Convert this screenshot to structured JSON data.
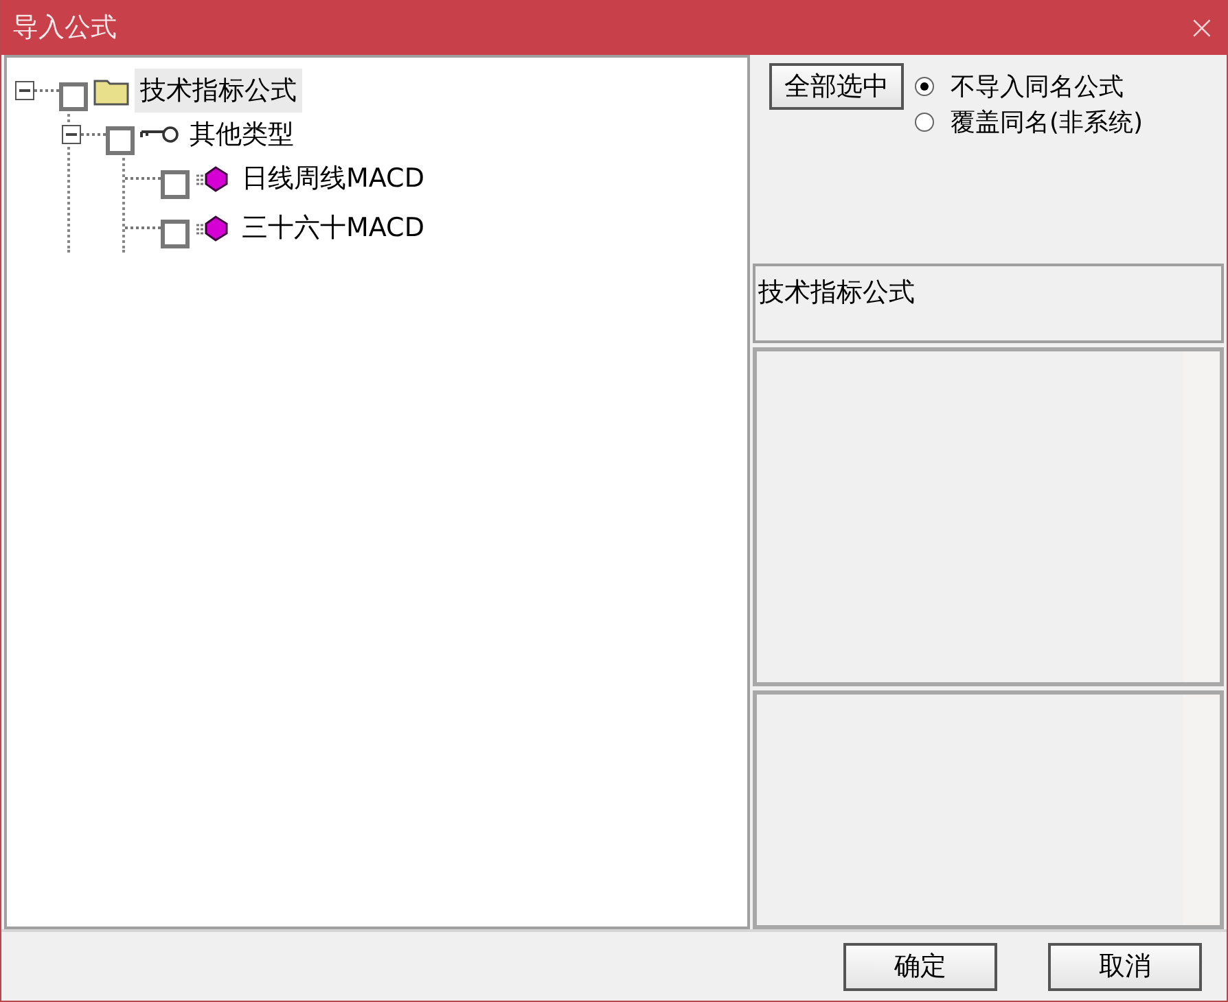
{
  "window": {
    "title": "导入公式",
    "close": "×"
  },
  "tree": [
    {
      "kind": "folder",
      "label": "技术指标公式",
      "checked": false,
      "selected": true,
      "expanded": true,
      "children": [
        {
          "kind": "group",
          "label": "其他类型",
          "checked": false,
          "selected": false,
          "expanded": true,
          "children": [
            {
              "kind": "formula",
              "label": "日线周线MACD",
              "checked": false,
              "selected": false
            },
            {
              "kind": "formula",
              "label": "三十六十MACD",
              "checked": false,
              "selected": false
            }
          ]
        }
      ]
    }
  ],
  "select_all_button": "全部选中",
  "options": [
    {
      "label": "不导入同名公式",
      "selected": true
    },
    {
      "label": "覆盖同名(非系统)",
      "selected": false
    }
  ],
  "info_box": "技术指标公式",
  "buttons": [
    "确定",
    "取消"
  ]
}
